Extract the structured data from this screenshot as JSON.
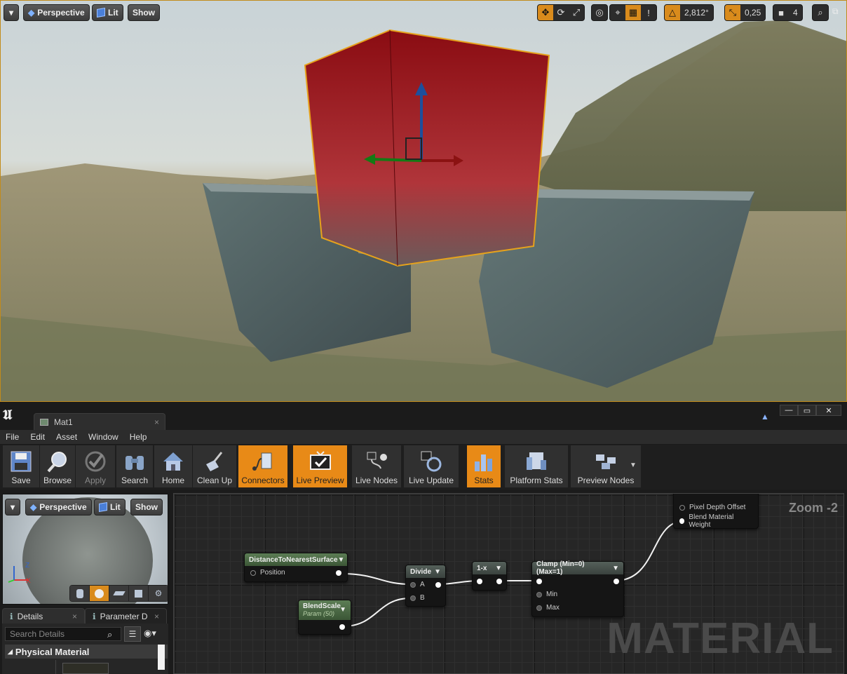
{
  "viewport": {
    "view_label": "Perspective",
    "lighting_label": "Lit",
    "show_label": "Show",
    "angle_snap": "2,812°",
    "scale_snap": "0,25",
    "camera_speed": "4"
  },
  "editor": {
    "tab_title": "Mat1",
    "menu": [
      "File",
      "Edit",
      "Asset",
      "Window",
      "Help"
    ],
    "toolbar": {
      "save": "Save",
      "browse": "Browse",
      "apply": "Apply",
      "search": "Search",
      "home": "Home",
      "clean_up": "Clean Up",
      "connectors": "Connectors",
      "live_preview": "Live Preview",
      "live_nodes": "Live Nodes",
      "live_update": "Live Update",
      "stats": "Stats",
      "platform_stats": "Platform Stats",
      "preview_nodes": "Preview Nodes"
    },
    "preview": {
      "view_label": "Perspective",
      "lighting_label": "Lit",
      "show_label": "Show",
      "axis_z": "Z",
      "axis_x": "X"
    },
    "details": {
      "tab_details": "Details",
      "tab_params": "Parameter D",
      "search_placeholder": "Search Details",
      "category": "Physical Material"
    },
    "graph": {
      "zoom": "Zoom -2",
      "watermark": "MATERIAL",
      "nodes": {
        "distance": {
          "title": "DistanceToNearestSurface",
          "input": "Position"
        },
        "blendscale": {
          "title": "BlendScale",
          "subtitle": "Param (50)"
        },
        "divide": {
          "title": "Divide",
          "a": "A",
          "b": "B"
        },
        "oneminus": {
          "title": "1-x"
        },
        "clamp": {
          "title": "Clamp (Min=0) (Max=1)",
          "min": "Min",
          "max": "Max"
        },
        "result": {
          "pin1": "Pixel Depth Offset",
          "pin2": "Blend Material Weight"
        }
      }
    }
  },
  "colors": {
    "accent": "#e88a17",
    "selection": "#c28b1a",
    "node_header": "#4f6e48"
  }
}
